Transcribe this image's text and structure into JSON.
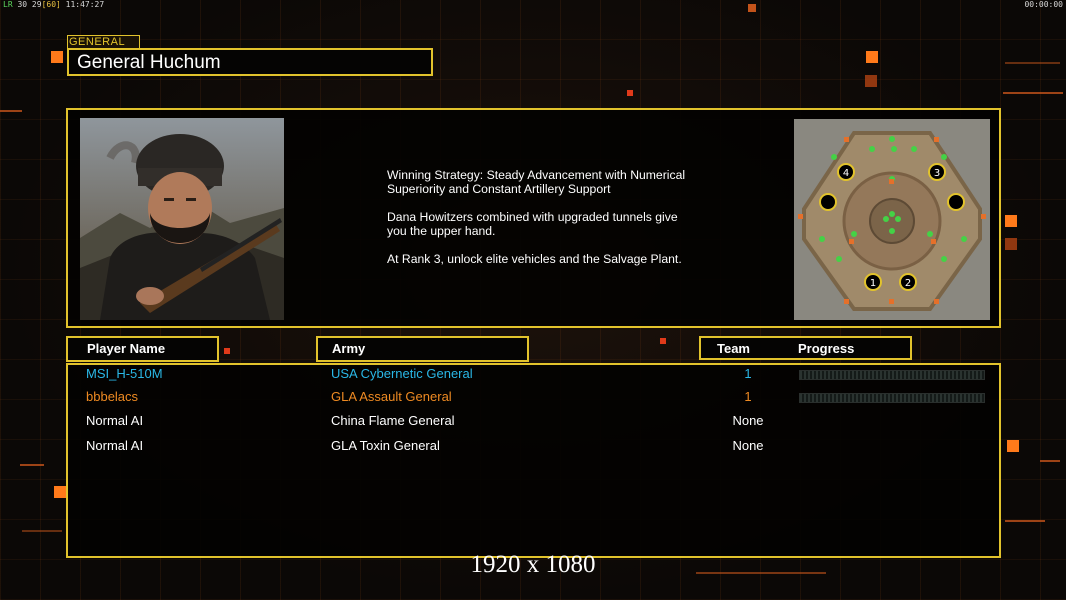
{
  "topbar": {
    "fps_label": "LR",
    "fps_values": "30 29",
    "fps_cap": "[60]",
    "clock": "11:47:27",
    "game_timer": "00:00:00"
  },
  "general": {
    "section_label": "GENERAL",
    "name": "General Huchum"
  },
  "description": {
    "strategy": "Winning Strategy: Steady Advancement with Numerical\n Superiority and Constant Artillery Support",
    "tip": "Dana Howitzers combined with upgraded tunnels give\n you the upper hand.",
    "rank": "At Rank 3, unlock elite vehicles and the Salvage Plant."
  },
  "minimap": {
    "start_positions": [
      "1",
      "2",
      "3",
      "4"
    ]
  },
  "table": {
    "headers": {
      "player": "Player Name",
      "army": "Army",
      "team": "Team",
      "progress": "Progress"
    },
    "rows": [
      {
        "name": "MSI_H-510M",
        "army": "USA Cybernetic General",
        "team": "1",
        "color": "#2ab7e6",
        "progress": 0
      },
      {
        "name": "bbbelacs",
        "army": "GLA Assault General",
        "team": "1",
        "color": "#ee8a22",
        "progress": 0
      },
      {
        "name": "Normal AI",
        "army": "China Flame General",
        "team": "None",
        "color": "#ffffff"
      },
      {
        "name": "Normal AI",
        "army": "GLA Toxin General",
        "team": "None",
        "color": "#ffffff"
      }
    ]
  },
  "caption": "1920 x 1080",
  "colors": {
    "accent_border": "#e2c32c",
    "deco_orange": "#ff7a1a"
  }
}
